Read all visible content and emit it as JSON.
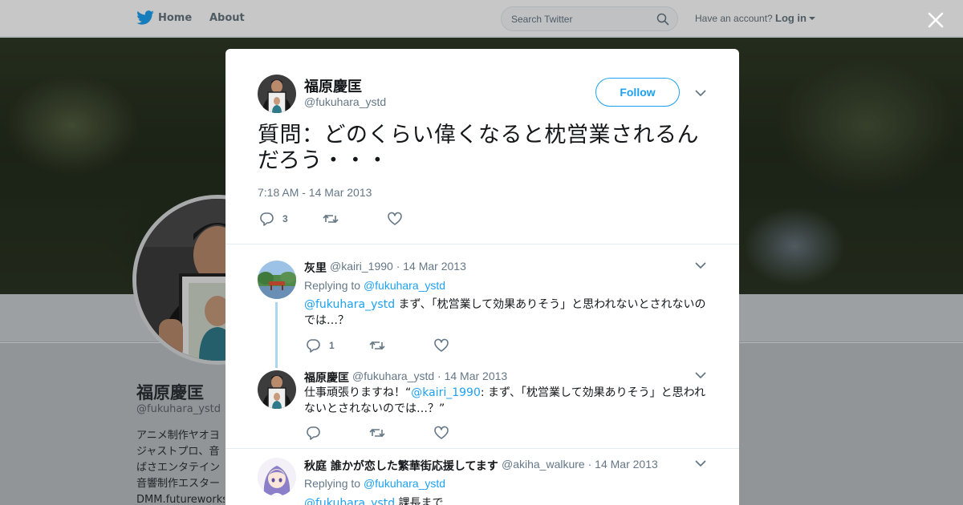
{
  "nav": {
    "home_label": "Home",
    "about_label": "About",
    "search_placeholder": "Search Twitter",
    "have_account": "Have an account?",
    "login_label": "Log in"
  },
  "background_profile": {
    "name": "福原慶匡",
    "handle": "@fukuhara_ystd",
    "bio_lines": [
      "アニメ制作ヤオヨ",
      "ジャストプロ、音",
      "ばさエンタテイン",
      "音響制作エスター",
      "DMM.futureworks"
    ]
  },
  "main_tweet": {
    "name": "福原慶匡",
    "handle": "@fukuhara_ystd",
    "follow_label": "Follow",
    "text": "質問：どのくらい偉くなると枕営業されるんだろう・・・",
    "timestamp": "7:18 AM - 14 Mar 2013",
    "reply_count": "3"
  },
  "replies": [
    {
      "name": "灰里",
      "handle": "@kairi_1990",
      "date": "· 14 Mar 2013",
      "replying_label": "Replying to",
      "replying_to": "@fukuhara_ystd",
      "mention": "@fukuhara_ystd",
      "text": " まず、「枕営業して効果ありそう」と思われないとされないのでは…？",
      "reply_count": "1"
    },
    {
      "name": "福原慶匡",
      "handle": "@fukuhara_ystd",
      "date": "· 14 Mar 2013",
      "text_pre": "仕事頑張りますね！“",
      "mention": "@kairi_1990",
      "text_post": ": まず、「枕営業して効果ありそう」と思われないとされないのでは…？”",
      "reply_count": ""
    },
    {
      "name": "秋庭 誰かが恋した繁華街応援してます",
      "handle": "@akiha_walkure",
      "date": "· 14 Mar 2013",
      "replying_label": "Replying to",
      "replying_to": "@fukuhara_ystd",
      "mention": "@fukuhara_ystd",
      "text": " 課長まで"
    }
  ],
  "colors": {
    "accent": "#1da1f2",
    "secondary_text": "#657786",
    "thread_line": "#a8d7f4"
  },
  "icons": [
    "twitter-bird-icon",
    "search-icon",
    "close-icon",
    "chevron-down-icon",
    "reply-icon",
    "retweet-icon",
    "like-icon"
  ]
}
